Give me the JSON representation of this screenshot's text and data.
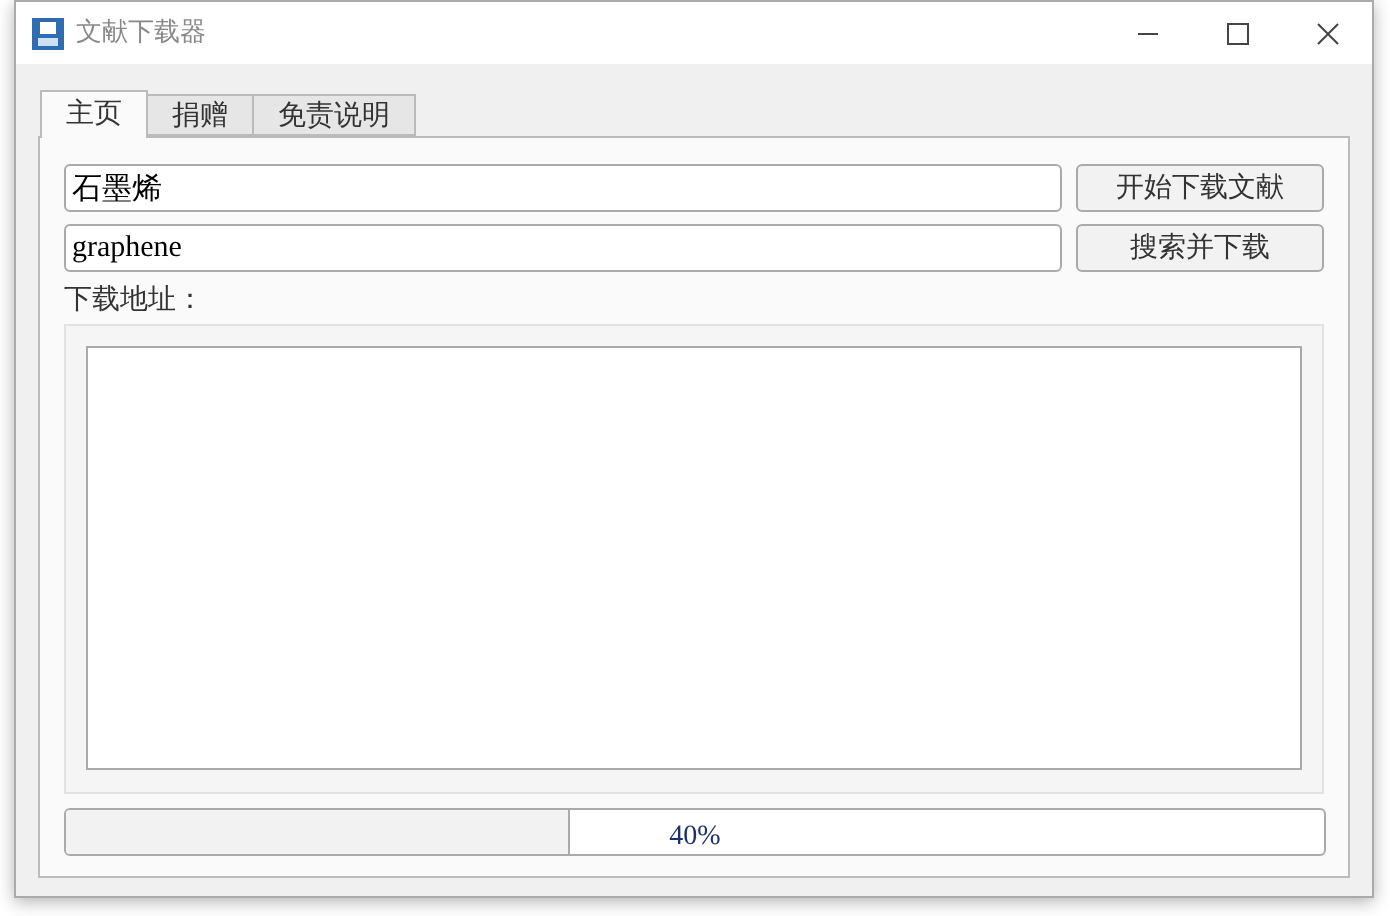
{
  "window": {
    "title": "文献下载器"
  },
  "tabs": [
    {
      "label": "主页",
      "selected": true
    },
    {
      "label": "捐赠",
      "selected": false
    },
    {
      "label": "免责说明",
      "selected": false
    }
  ],
  "keyword_field": {
    "value": "石墨烯"
  },
  "start_button": {
    "label": "开始下载文献"
  },
  "search_field": {
    "value": "graphene"
  },
  "search_button": {
    "label": "搜索并下载"
  },
  "address_label": "下载地址：",
  "progress": {
    "level": 0.4,
    "reading": "40%"
  }
}
